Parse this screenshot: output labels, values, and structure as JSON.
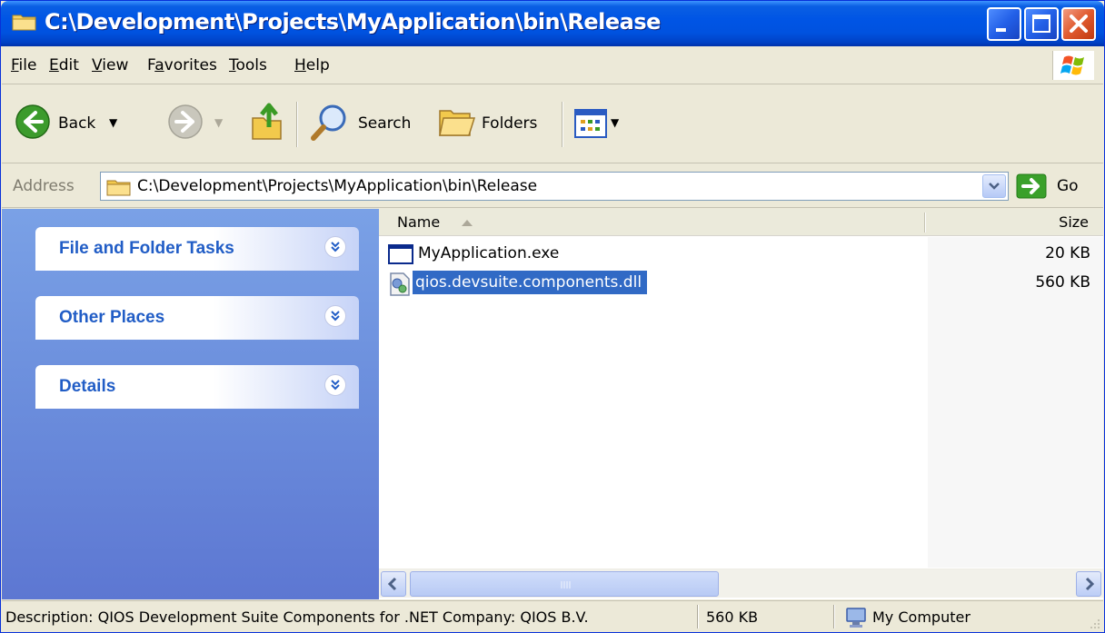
{
  "window": {
    "title": "C:\\Development\\Projects\\MyApplication\\bin\\Release"
  },
  "menu": {
    "items": [
      {
        "label": "File",
        "accel": "F"
      },
      {
        "label": "Edit",
        "accel": "E"
      },
      {
        "label": "View",
        "accel": "V"
      },
      {
        "label": "Favorites",
        "accel": "a"
      },
      {
        "label": "Tools",
        "accel": "T"
      },
      {
        "label": "Help",
        "accel": "H"
      }
    ]
  },
  "toolbar": {
    "back_label": "Back",
    "search_label": "Search",
    "folders_label": "Folders"
  },
  "address": {
    "label": "Address",
    "value": "C:\\Development\\Projects\\MyApplication\\bin\\Release",
    "go_label": "Go"
  },
  "tasks": [
    {
      "title": "File and Folder Tasks"
    },
    {
      "title": "Other Places"
    },
    {
      "title": "Details"
    }
  ],
  "list": {
    "columns": [
      "Name",
      "Size"
    ],
    "rows": [
      {
        "name": "MyApplication.exe",
        "size": "20 KB",
        "selected": false
      },
      {
        "name": "qios.devsuite.components.dll",
        "size": "560 KB",
        "selected": true
      }
    ]
  },
  "status": {
    "description": "Description: QIOS Development Suite Components for .NET Company: QIOS B.V.",
    "size": "560 KB",
    "location": "My Computer"
  },
  "colors": {
    "titlebar": "#0055e5",
    "selection": "#316ac5",
    "taskpane_title": "#215dc6"
  }
}
